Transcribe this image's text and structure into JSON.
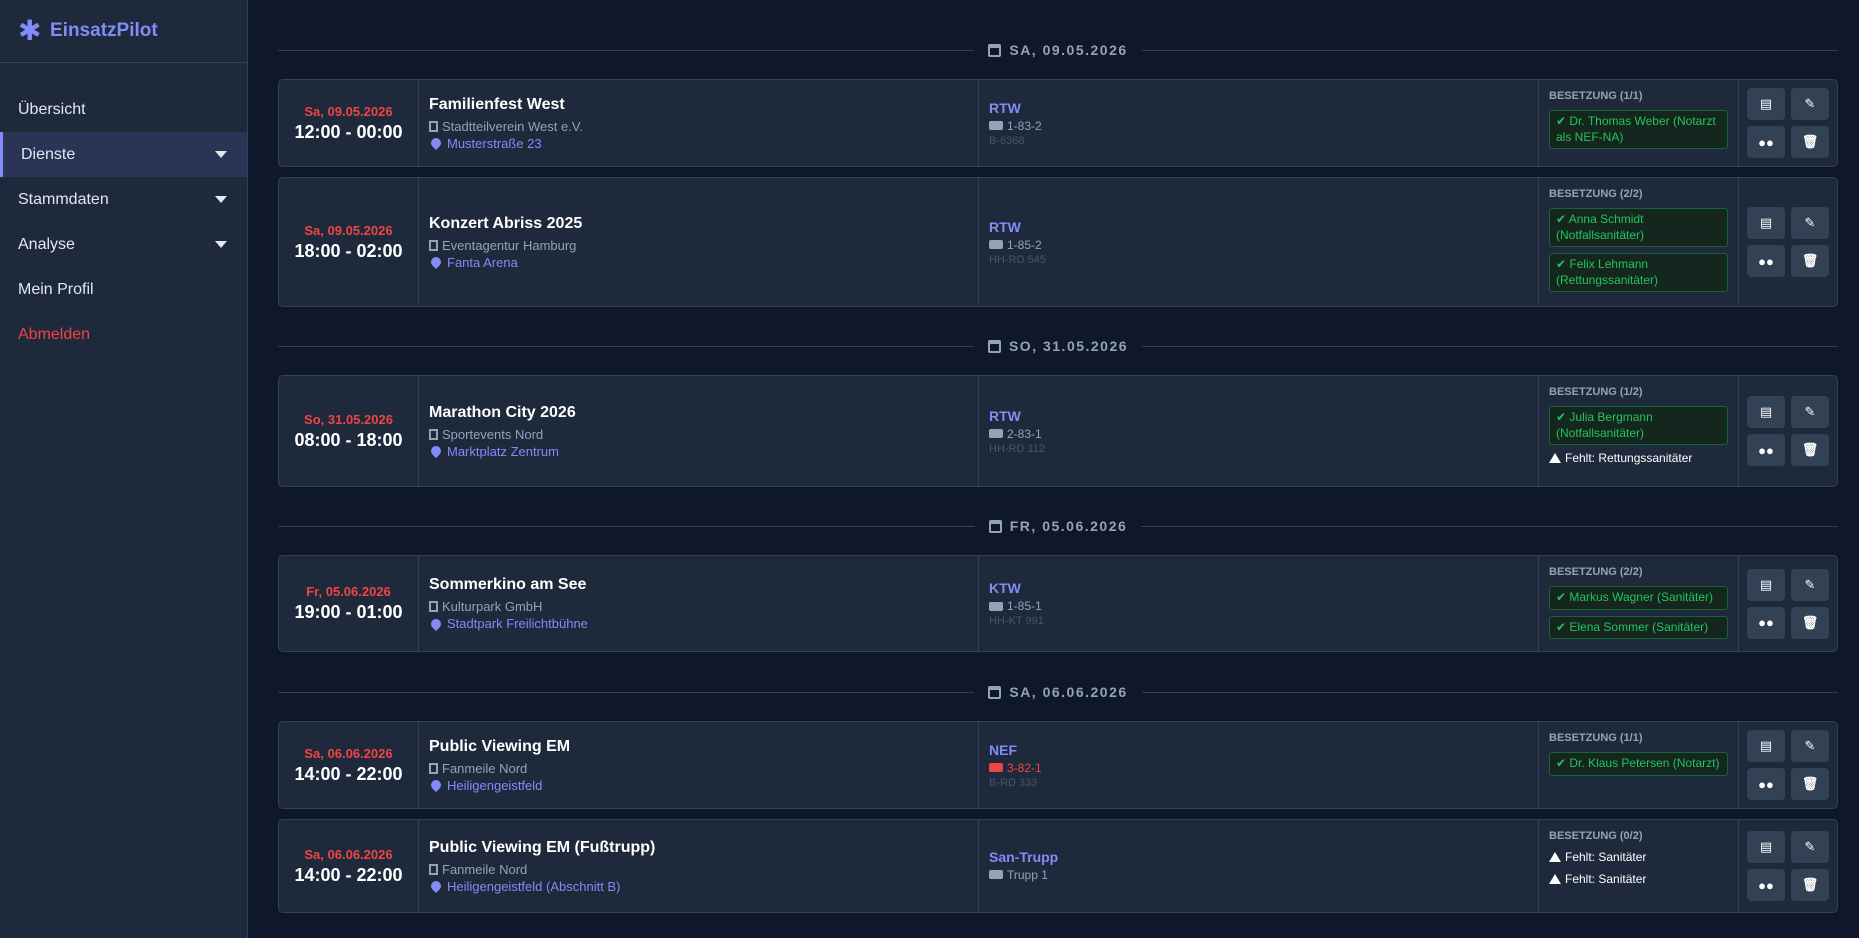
{
  "app": {
    "name": "EinsatzPilot",
    "icon": "asterisk-icon"
  },
  "sidebar": {
    "items": [
      {
        "label": "Übersicht"
      },
      {
        "label": "Dienste"
      },
      {
        "label": "Stammdaten"
      },
      {
        "label": "Analyse"
      },
      {
        "label": "Mein Profil"
      },
      {
        "label": "Abmelden"
      }
    ]
  },
  "dates": [
    {
      "label": "SA, 09.05.2026"
    },
    {
      "label": "SO, 31.05.2026"
    },
    {
      "label": "FR, 05.06.2026"
    },
    {
      "label": "SA, 06.06.2026"
    }
  ],
  "events": [
    {
      "date": "Sa, 09.05.2026",
      "time": "12:00 - 00:00",
      "title": "Familienfest West",
      "org": "Stadtteilverein West e.V.",
      "location": "Musterstraße 23",
      "vehicle": {
        "type": "RTW",
        "callsign": "1-83-2",
        "plate": "B-6368"
      },
      "staffing": {
        "header": "BESETZUNG (1/1)",
        "assigned": [
          "Dr. Thomas Weber (Notarzt als NEF-NA)"
        ],
        "missing": []
      }
    },
    {
      "date": "Sa, 09.05.2026",
      "time": "18:00 - 02:00",
      "title": "Konzert Abriss 2025",
      "org": "Eventagentur Hamburg",
      "location": "Fanta Arena",
      "vehicle": {
        "type": "RTW",
        "callsign": "1-85-2",
        "plate": "HH-RD 545"
      },
      "staffing": {
        "header": "BESETZUNG (2/2)",
        "assigned": [
          "Anna Schmidt (Notfallsanitäter)",
          "Felix Lehmann (Rettungssanitäter)"
        ],
        "missing": []
      }
    },
    {
      "date": "So, 31.05.2026",
      "time": "08:00 - 18:00",
      "title": "Marathon City 2026",
      "org": "Sportevents Nord",
      "location": "Marktplatz Zentrum",
      "vehicle": {
        "type": "RTW",
        "callsign": "2-83-1",
        "plate": "HH-RD 112"
      },
      "staffing": {
        "header": "BESETZUNG (1/2)",
        "assigned": [
          "Julia Bergmann (Notfallsanitäter)"
        ],
        "missing": [
          "Fehlt: Rettungssanitäter"
        ]
      }
    },
    {
      "date": "Fr, 05.06.2026",
      "time": "19:00 - 01:00",
      "title": "Sommerkino am See",
      "org": "Kulturpark GmbH",
      "location": "Stadtpark Freilichtbühne",
      "vehicle": {
        "type": "KTW",
        "callsign": "1-85-1",
        "plate": "HH-KT 991"
      },
      "staffing": {
        "header": "BESETZUNG (2/2)",
        "assigned": [
          "Markus Wagner (Sanitäter)",
          "Elena Sommer (Sanitäter)"
        ],
        "missing": []
      }
    },
    {
      "date": "Sa, 06.06.2026",
      "time": "14:00 - 22:00",
      "title": "Public Viewing EM",
      "org": "Fanmeile Nord",
      "location": "Heiligengeistfeld",
      "vehicle": {
        "type": "NEF",
        "callsign": "3-82-1",
        "plate": "B-RD 333",
        "callsign_color": "#ef4444"
      },
      "staffing": {
        "header": "BESETZUNG (1/1)",
        "assigned": [
          "Dr. Klaus Petersen (Notarzt)"
        ],
        "missing": []
      }
    },
    {
      "date": "Sa, 06.06.2026",
      "time": "14:00 - 22:00",
      "title": "Public Viewing EM (Fußtrupp)",
      "org": "Fanmeile Nord",
      "location": "Heiligengeistfeld (Abschnitt B)",
      "vehicle": {
        "type": "San-Trupp",
        "callsign": "Trupp 1",
        "plate": ""
      },
      "staffing": {
        "header": "BESETZUNG (0/2)",
        "assigned": [],
        "missing": [
          "Fehlt: Sanitäter",
          "Fehlt: Sanitäter"
        ]
      }
    }
  ],
  "actions": {
    "pdf_icon": "file-pdf-icon",
    "edit_icon": "edit-icon",
    "staff_icon": "users-icon",
    "delete_icon": "trash-icon"
  },
  "colors": {
    "accent": "#818cf8",
    "danger": "#ef4444",
    "success": "#22c55e",
    "bg": "#0f172a",
    "card": "#1e293b"
  }
}
